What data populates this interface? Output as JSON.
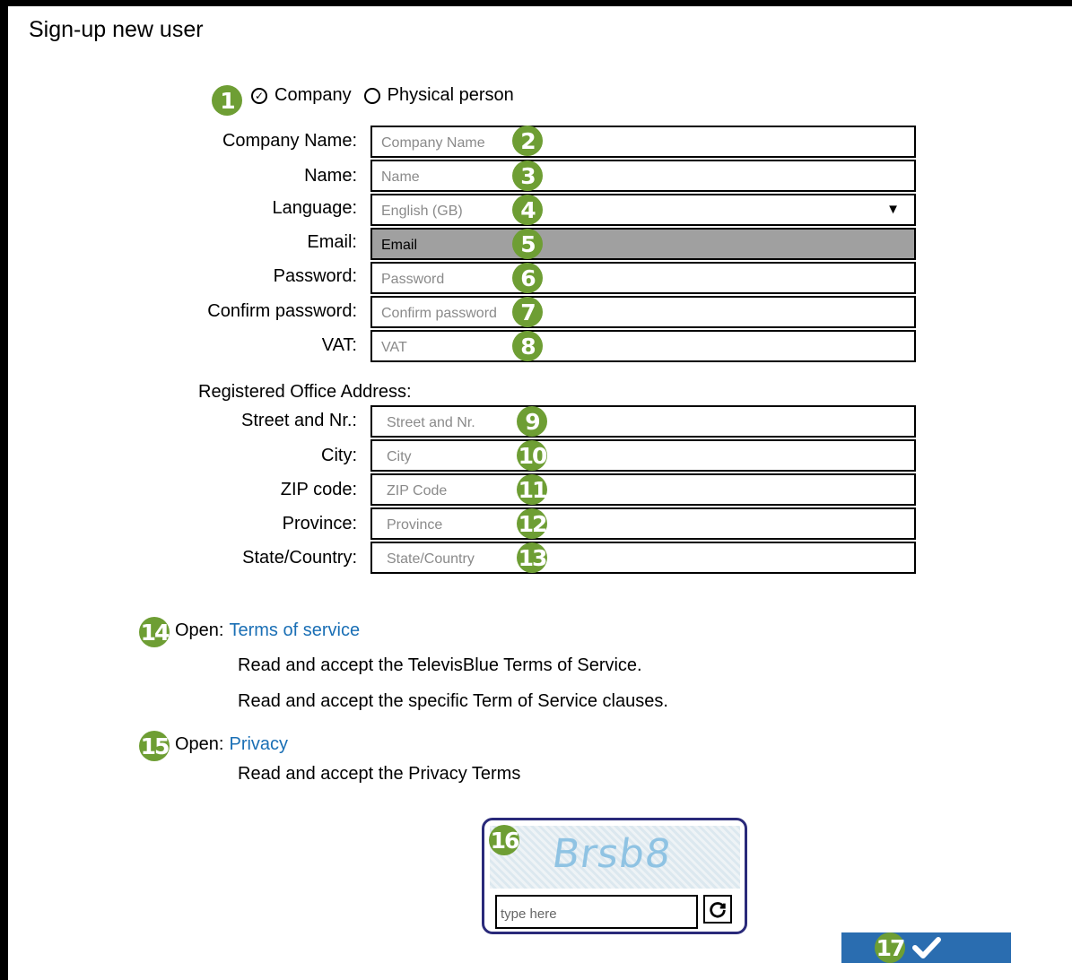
{
  "page": {
    "title": "Sign-up new user"
  },
  "user_type": {
    "options": [
      {
        "label": "Company",
        "selected": true
      },
      {
        "label": "Physical person",
        "selected": false
      }
    ]
  },
  "form": {
    "company_name": {
      "label": "Company Name:",
      "placeholder": "Company Name"
    },
    "name": {
      "label": "Name:",
      "placeholder": "Name"
    },
    "language": {
      "label": "Language:",
      "value": "English (GB)"
    },
    "email": {
      "label": "Email:",
      "placeholder": "Email"
    },
    "password": {
      "label": "Password:",
      "placeholder": "Password"
    },
    "confirm_password": {
      "label": "Confirm password:",
      "placeholder": "Confirm password"
    },
    "vat": {
      "label": "VAT:",
      "placeholder": "VAT"
    }
  },
  "address": {
    "heading": "Registered Office Address:",
    "street": {
      "label": "Street and Nr.:",
      "placeholder": "Street and Nr."
    },
    "city": {
      "label": "City:",
      "placeholder": "City"
    },
    "zip": {
      "label": "ZIP code:",
      "placeholder": "ZIP Code"
    },
    "province": {
      "label": "Province:",
      "placeholder": "Province"
    },
    "state": {
      "label": "State/Country:",
      "placeholder": "State/Country"
    }
  },
  "terms": {
    "open_label": "Open:",
    "link": "Terms of service",
    "line1": "Read and accept the TelevisBlue Terms of Service.",
    "line2": "Read and accept the specific Term of Service clauses."
  },
  "privacy": {
    "open_label": "Open:",
    "link": "Privacy",
    "line1": "Read and accept the Privacy Terms"
  },
  "captcha": {
    "image_text": "Brsb8",
    "placeholder": "type here",
    "refresh_icon": "refresh-icon"
  },
  "submit": {
    "icon": "checkmark-icon"
  },
  "markers": [
    "1",
    "2",
    "3",
    "4",
    "5",
    "6",
    "7",
    "8",
    "9",
    "10",
    "11",
    "12",
    "13",
    "14",
    "15",
    "16",
    "17"
  ],
  "colors": {
    "marker": "#6e9e34",
    "link": "#1a6fb5",
    "submit": "#2a6db0",
    "captcha_border": "#2a2a7a",
    "email_bg": "#a0a0a0"
  }
}
